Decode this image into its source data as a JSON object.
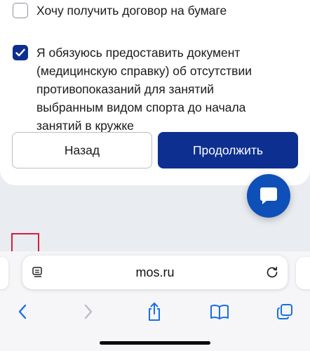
{
  "form": {
    "paper_contract": {
      "label": "Хочу получить договор на бумаге",
      "checked": false
    },
    "medical_certificate": {
      "label": "Я обязуюсь предоставить документ (медицинскую справку) об отсутствии противопоказаний для занятий выбранным видом спорта до начала занятий в кружке",
      "checked": true
    },
    "back_label": "Назад",
    "continue_label": "Продолжить"
  },
  "chat": {
    "icon": "chat-bubble-icon"
  },
  "browser": {
    "url": "mos.ru",
    "icons": [
      "reader-icon",
      "reload-icon",
      "back-arrow-icon",
      "forward-arrow-icon",
      "share-icon",
      "bookmarks-icon",
      "tabs-icon"
    ]
  },
  "colors": {
    "primary": "#0d2f8f",
    "fab": "#0f4fb8",
    "accent_red": "#d41f3c"
  }
}
